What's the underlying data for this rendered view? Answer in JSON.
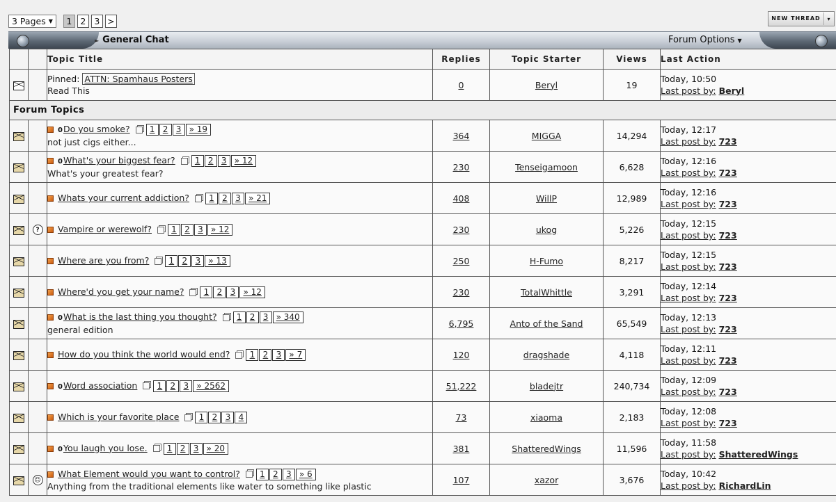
{
  "pager": {
    "pages_label": "3 Pages",
    "pages": [
      "1",
      "2",
      "3"
    ],
    "current": "1",
    "next": ">"
  },
  "new_thread_label": "NEW THREAD",
  "header": {
    "forum_title": "General Chat",
    "options_label": "Forum Options"
  },
  "columns": {
    "title": "Topic Title",
    "replies": "Replies",
    "starter": "Topic Starter",
    "views": "Views",
    "last": "Last Action"
  },
  "pinned": {
    "prefix": "Pinned:",
    "title": "ATTN: Spamhaus Posters",
    "desc": "Read This",
    "replies": "0",
    "starter": "Beryl",
    "views": "19",
    "time": "Today, 10:50",
    "lastby_label": "Last post by:",
    "lastby": "Beryl"
  },
  "section_label": "Forum Topics",
  "topics": [
    {
      "title": "Do you smoke?",
      "desc": "not just cigs either...",
      "pages": [
        "1",
        "2",
        "3"
      ],
      "more": "» 19",
      "replies": "364",
      "starter": "MIGGA",
      "views": "14,294",
      "time": "Today, 12:17",
      "lastby": "723",
      "icon": ""
    },
    {
      "title": "What's your biggest fear?",
      "desc": "What's your greatest fear?",
      "pages": [
        "1",
        "2",
        "3"
      ],
      "more": "» 12",
      "replies": "230",
      "starter": "Tenseigamoon",
      "views": "6,628",
      "time": "Today, 12:16",
      "lastby": "723",
      "icon": ""
    },
    {
      "title": "Whats your current addiction?",
      "desc": "",
      "pages": [
        "1",
        "2",
        "3"
      ],
      "more": "» 21",
      "replies": "408",
      "starter": "WillP",
      "views": "12,989",
      "time": "Today, 12:16",
      "lastby": "723",
      "icon": ""
    },
    {
      "title": "Vampire or werewolf?",
      "desc": "",
      "pages": [
        "1",
        "2",
        "3"
      ],
      "more": "» 12",
      "replies": "230",
      "starter": "ukog",
      "views": "5,226",
      "time": "Today, 12:15",
      "lastby": "723",
      "icon": "?"
    },
    {
      "title": "Where are you from?",
      "desc": "",
      "pages": [
        "1",
        "2",
        "3"
      ],
      "more": "» 13",
      "replies": "250",
      "starter": "H-Fumo",
      "views": "8,217",
      "time": "Today, 12:15",
      "lastby": "723",
      "icon": ""
    },
    {
      "title": "Where'd you get your name?",
      "desc": "",
      "pages": [
        "1",
        "2",
        "3"
      ],
      "more": "» 12",
      "replies": "230",
      "starter": "TotalWhittle",
      "views": "3,291",
      "time": "Today, 12:14",
      "lastby": "723",
      "icon": ""
    },
    {
      "title": "What is the last thing you thought?",
      "desc": "general edition",
      "pages": [
        "1",
        "2",
        "3"
      ],
      "more": "» 340",
      "replies": "6,795",
      "starter": "Anto of the Sand",
      "views": "65,549",
      "time": "Today, 12:13",
      "lastby": "723",
      "icon": ""
    },
    {
      "title": "How do you think the world would end?",
      "desc": "",
      "pages": [
        "1",
        "2",
        "3"
      ],
      "more": "» 7",
      "replies": "120",
      "starter": "dragshade",
      "views": "4,118",
      "time": "Today, 12:11",
      "lastby": "723",
      "icon": ""
    },
    {
      "title": "Word association",
      "desc": "",
      "pages": [
        "1",
        "2",
        "3"
      ],
      "more": "» 2562",
      "replies": "51,222",
      "starter": "bladejtr",
      "views": "240,734",
      "time": "Today, 12:09",
      "lastby": "723",
      "icon": ""
    },
    {
      "title": "Which is your favorite place",
      "desc": "",
      "pages": [
        "1",
        "2",
        "3",
        "4"
      ],
      "more": "",
      "replies": "73",
      "starter": "xiaoma",
      "views": "2,183",
      "time": "Today, 12:08",
      "lastby": "723",
      "icon": ""
    },
    {
      "title": "You laugh you lose.",
      "desc": "",
      "pages": [
        "1",
        "2",
        "3"
      ],
      "more": "» 20",
      "replies": "381",
      "starter": "ShatteredWings",
      "views": "11,596",
      "time": "Today, 11:58",
      "lastby": "ShatteredWings",
      "icon": ""
    },
    {
      "title": "What Element would you want to control?",
      "desc": "Anything from the traditional elements like water to something like plastic",
      "pages": [
        "1",
        "2",
        "3"
      ],
      "more": "» 6",
      "replies": "107",
      "starter": "xazor",
      "views": "3,676",
      "time": "Today, 10:42",
      "lastby": "RichardLin",
      "icon": "☺"
    }
  ],
  "dotted": [
    true,
    true,
    false,
    false,
    false,
    false,
    true,
    false,
    true,
    false,
    true,
    false
  ]
}
